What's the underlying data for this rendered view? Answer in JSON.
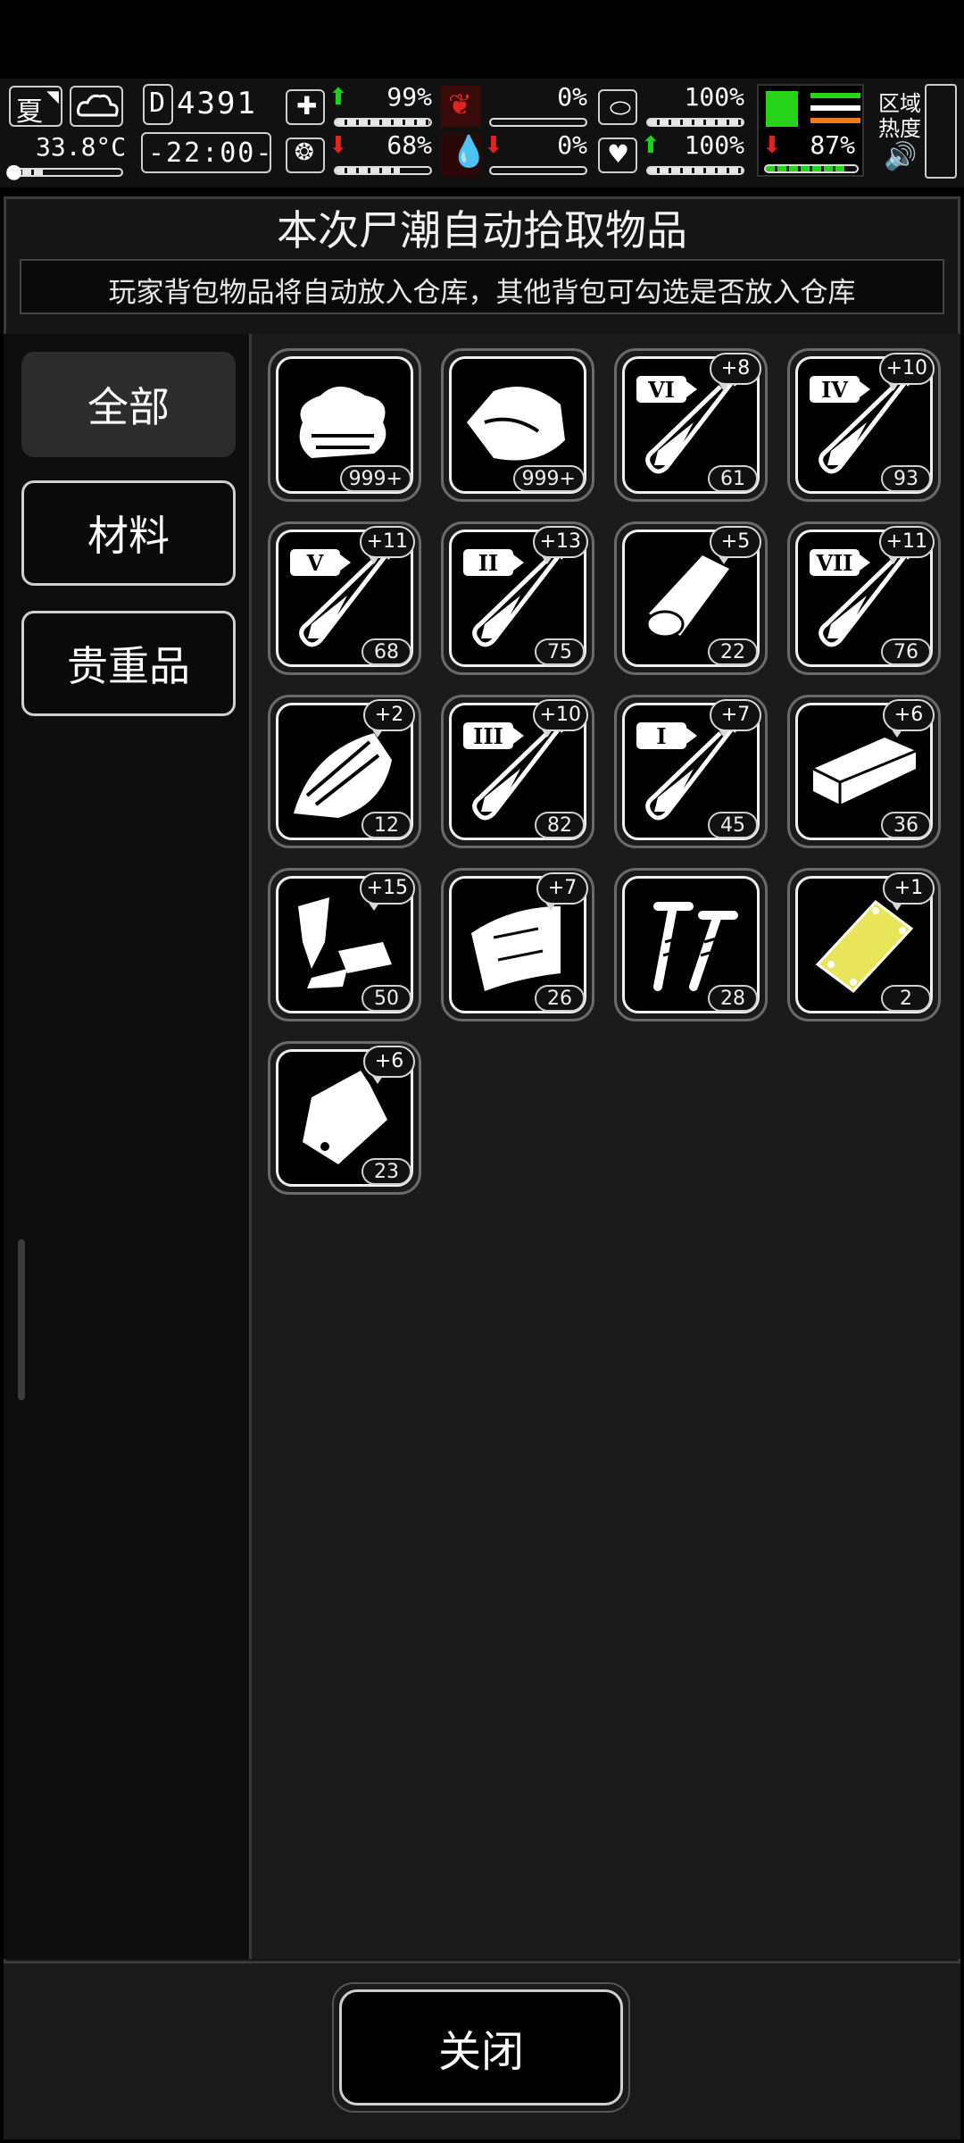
{
  "status": {
    "season": "夏",
    "temperature": "33.8°C",
    "day_counter": "4391",
    "day_prefix": "D",
    "time": "-22:00-",
    "health_pct": "99%",
    "hunger_pct": "0%",
    "pill_pct": "100%",
    "brain_pct": "68%",
    "blood_pct": "0%",
    "heart_pct": "100%",
    "stamina_pct": "87%",
    "region_heat_label_1": "区域",
    "region_heat_label_2": "热度",
    "levels": {
      "health": 0.99,
      "hunger": 0.0,
      "pill": 1.0,
      "brain": 0.68,
      "blood": 0.0,
      "heart": 1.0,
      "stamina": 0.87
    },
    "colors": {
      "up": "#22d21a",
      "down": "#e32222",
      "accent_green": "#27d41a",
      "accent_orange": "#f07a1a"
    }
  },
  "panel": {
    "title": "本次尸潮自动拾取物品",
    "subtitle": "玩家背包物品将自动放入仓库，其他背包可勾选是否放入仓库"
  },
  "tabs": [
    {
      "label": "全部",
      "active": true
    },
    {
      "label": "材料",
      "active": false
    },
    {
      "label": "贵重品",
      "active": false
    }
  ],
  "items": [
    {
      "icon": "cloth-icon",
      "count": "999+",
      "bonus": ""
    },
    {
      "icon": "meat-icon",
      "count": "999+",
      "bonus": ""
    },
    {
      "icon": "test-tube-icon",
      "tier": "VI",
      "count": "61",
      "bonus": "+8"
    },
    {
      "icon": "test-tube-icon",
      "tier": "IV",
      "count": "93",
      "bonus": "+10"
    },
    {
      "icon": "test-tube-icon",
      "tier": "V",
      "count": "68",
      "bonus": "+11"
    },
    {
      "icon": "test-tube-icon",
      "tier": "II",
      "count": "75",
      "bonus": "+13"
    },
    {
      "icon": "wood-log-icon",
      "count": "22",
      "bonus": "+5"
    },
    {
      "icon": "test-tube-icon",
      "tier": "VII",
      "count": "76",
      "bonus": "+11"
    },
    {
      "icon": "wood-scrap-icon",
      "count": "12",
      "bonus": "+2"
    },
    {
      "icon": "test-tube-icon",
      "tier": "III",
      "count": "82",
      "bonus": "+10"
    },
    {
      "icon": "test-tube-icon",
      "tier": "I",
      "count": "45",
      "bonus": "+7"
    },
    {
      "icon": "plank-icon",
      "count": "36",
      "bonus": "+6"
    },
    {
      "icon": "scrap-metal-icon",
      "count": "50",
      "bonus": "+15"
    },
    {
      "icon": "leather-icon",
      "count": "26",
      "bonus": "+7"
    },
    {
      "icon": "screws-icon",
      "count": "28",
      "bonus": ""
    },
    {
      "icon": "gold-plate-icon",
      "count": "2",
      "bonus": "+1"
    },
    {
      "icon": "bag-icon",
      "count": "23",
      "bonus": "+6"
    }
  ],
  "close_label": "关闭"
}
